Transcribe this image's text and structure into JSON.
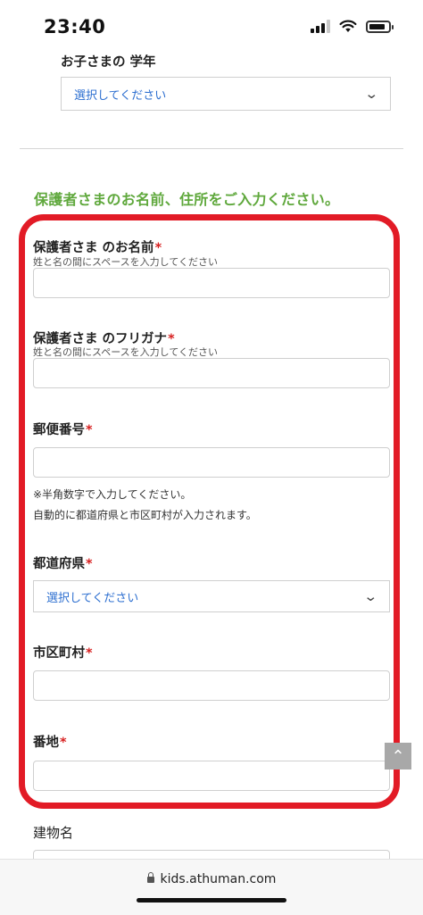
{
  "status_bar": {
    "time": "23:40",
    "battery_level": 0.85
  },
  "child_grade": {
    "label": "お子さまの 学年",
    "placeholder": "選択してください"
  },
  "section_title": "保護者さまのお名前、住所をご入力ください。",
  "form": {
    "guardian_name": {
      "label": "保護者さま のお名前",
      "required_mark": "*",
      "hint": "姓と名の間にスペースを入力してください"
    },
    "guardian_kana": {
      "label": "保護者さま のフリガナ",
      "required_mark": "*",
      "hint": "姓と名の間にスペースを入力してください"
    },
    "postal_code": {
      "label": "郵便番号",
      "required_mark": "*",
      "note_line1": "※半角数字で入力してください。",
      "note_line2": "自動的に都道府県と市区町村が入力されます。"
    },
    "prefecture": {
      "label": "都道府県",
      "required_mark": "*",
      "placeholder": "選択してください"
    },
    "city": {
      "label": "市区町村",
      "required_mark": "*"
    },
    "address": {
      "label": "番地",
      "required_mark": "*"
    },
    "building": {
      "label": "建物名"
    }
  },
  "browser": {
    "url": "kids.athuman.com"
  },
  "colors": {
    "accent_green": "#5fa83c",
    "highlight_red": "#e21b26",
    "link_blue": "#2d6fd0",
    "required_red": "#d72020"
  },
  "icons": [
    "signal-icon",
    "wifi-icon",
    "battery-icon",
    "chevron-down-icon",
    "scroll-top-icon",
    "lock-icon"
  ]
}
